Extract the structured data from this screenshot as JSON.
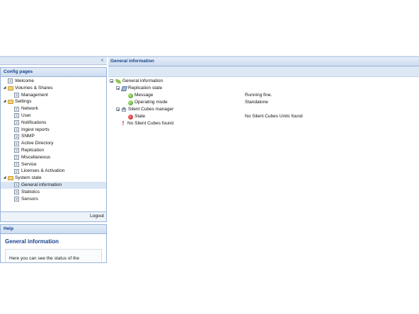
{
  "left": {
    "collapse_glyph": "«",
    "config_title": "Config pages",
    "logout": "Logout",
    "tree": [
      {
        "label": "Welcome",
        "icon": "page-icon",
        "indent": 0,
        "toggle": "",
        "selected": false
      },
      {
        "label": "Volumes & Shares",
        "icon": "folder-icon",
        "indent": 0,
        "toggle": "◢",
        "selected": false
      },
      {
        "label": "Management",
        "icon": "page-icon",
        "indent": 1,
        "toggle": "",
        "selected": false
      },
      {
        "label": "Settings",
        "icon": "folder-icon",
        "indent": 0,
        "toggle": "◢",
        "selected": false
      },
      {
        "label": "Network",
        "icon": "page-icon",
        "indent": 1,
        "toggle": "",
        "selected": false
      },
      {
        "label": "User",
        "icon": "page-icon",
        "indent": 1,
        "toggle": "",
        "selected": false
      },
      {
        "label": "Notifications",
        "icon": "page-icon",
        "indent": 1,
        "toggle": "",
        "selected": false
      },
      {
        "label": "Ingest reports",
        "icon": "page-icon",
        "indent": 1,
        "toggle": "",
        "selected": false
      },
      {
        "label": "SNMP",
        "icon": "page-icon",
        "indent": 1,
        "toggle": "",
        "selected": false
      },
      {
        "label": "Active Directory",
        "icon": "page-icon",
        "indent": 1,
        "toggle": "",
        "selected": false
      },
      {
        "label": "Replication",
        "icon": "page-icon",
        "indent": 1,
        "toggle": "",
        "selected": false
      },
      {
        "label": "Miscellaneous",
        "icon": "page-icon",
        "indent": 1,
        "toggle": "",
        "selected": false
      },
      {
        "label": "Service",
        "icon": "page-icon",
        "indent": 1,
        "toggle": "",
        "selected": false
      },
      {
        "label": "Licenses & Activation",
        "icon": "page-icon",
        "indent": 1,
        "toggle": "",
        "selected": false
      },
      {
        "label": "System state",
        "icon": "folder-icon",
        "indent": 0,
        "toggle": "◢",
        "selected": false
      },
      {
        "label": "General information",
        "icon": "page-icon",
        "indent": 1,
        "toggle": "",
        "selected": true
      },
      {
        "label": "Statistics",
        "icon": "page-icon",
        "indent": 1,
        "toggle": "",
        "selected": false
      },
      {
        "label": "Sensors",
        "icon": "page-icon",
        "indent": 1,
        "toggle": "",
        "selected": false
      }
    ]
  },
  "help": {
    "title": "Help",
    "heading": "General information",
    "text": "Here you can see the status of the"
  },
  "main": {
    "title": "General information",
    "tree": [
      {
        "label": "General information",
        "value": ""
      },
      {
        "label": "Replication state",
        "value": ""
      },
      {
        "label": "Message",
        "value": "Running fine."
      },
      {
        "label": "Operating mode",
        "value": "Standalone"
      },
      {
        "label": "Silent Cubes manager",
        "value": ""
      },
      {
        "label": "State",
        "value": "No Silent Cubes Units found"
      },
      {
        "label": "No Silent Cubes found",
        "value": ""
      }
    ]
  },
  "colors": {
    "accent": "#15428b",
    "header_bg": "#cddcf0",
    "selected_bg": "#dbe6f4",
    "error": "#c21414",
    "ok": "#3b9a1a"
  }
}
